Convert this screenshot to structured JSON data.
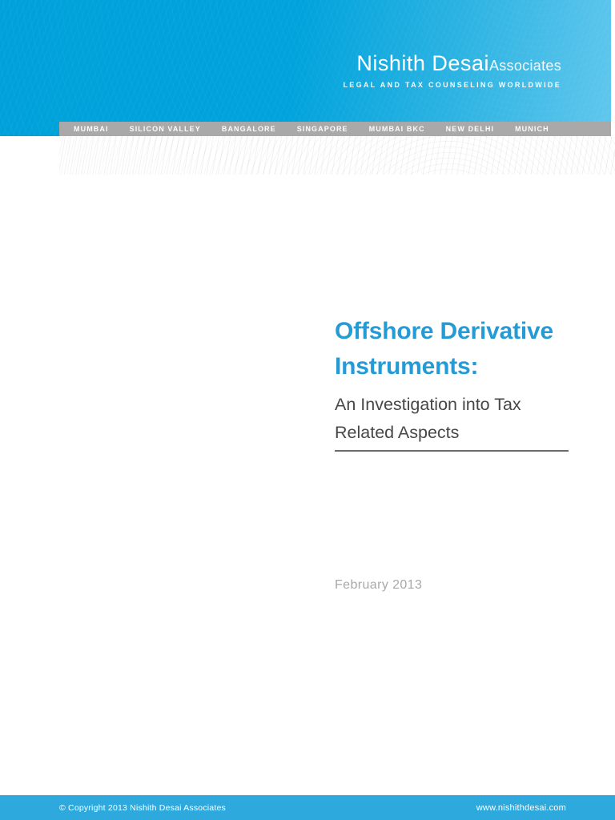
{
  "header": {
    "logo_primary": "Nishith Desai",
    "logo_secondary": "Associates",
    "tagline": "LEGAL AND TAX COUNSELING WORLDWIDE",
    "offices": [
      "MUMBAI",
      "SILICON VALLEY",
      "BANGALORE",
      "SINGAPORE",
      "MUMBAI BKC",
      "NEW DELHI",
      "MUNICH"
    ]
  },
  "cover": {
    "title": "Offshore Derivative\nInstruments:",
    "subtitle": "An Investigation into Tax\nRelated Aspects",
    "date": "February 2013"
  },
  "footer": {
    "copyright": "© Copyright 2013 Nishith Desai Associates",
    "website": "www.nishithdesai.com"
  },
  "colors": {
    "banner_blue": "#00a3dc",
    "banner_blue_light": "#60c7ed",
    "accent_blue": "#259bd6",
    "footer_blue": "#2ea9de",
    "office_bar_gray": "#a9a9a9",
    "subtitle_gray": "#474747",
    "date_gray": "#a8a8a8"
  }
}
